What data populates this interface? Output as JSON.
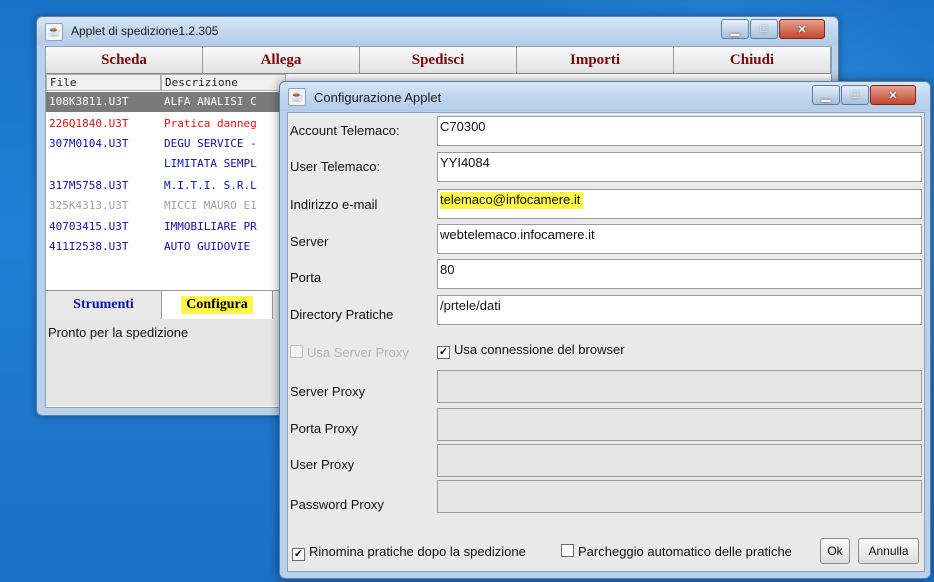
{
  "main_window": {
    "title": "Applet di spedizione1.2.305",
    "tabs": [
      "Scheda",
      "Allega",
      "Spedisci",
      "Importi",
      "Chiudi"
    ],
    "table": {
      "headers": [
        "File",
        "Descrizione"
      ],
      "rows": [
        {
          "file": "108K3811.U3T",
          "desc": "ALFA ANALISI C",
          "style": "sel"
        },
        {
          "file": "226Q1840.U3T",
          "desc": "Pratica danneg",
          "style": "red"
        },
        {
          "file": "307M0104.U3T",
          "desc": "DEGU SERVICE -",
          "style": "blue"
        },
        {
          "file": "",
          "desc": "LIMITATA SEMPL",
          "style": "blue"
        },
        {
          "file": "317M5758.U3T",
          "desc": "M.I.T.I. S.R.L",
          "style": "blue"
        },
        {
          "file": "325K4313.U3T",
          "desc": "MICCI MAURO E1",
          "style": "grey"
        },
        {
          "file": "40703415.U3T",
          "desc": "IMMOBILIARE PR",
          "style": "blue"
        },
        {
          "file": "411I2538.U3T",
          "desc": "AUTO GUIDOVIE",
          "style": "blue"
        }
      ]
    },
    "bottom_tabs": [
      "Strumenti",
      "Configura"
    ],
    "status": "Pronto per la spedizione"
  },
  "dialog": {
    "title": "Configurazione Applet",
    "fields": [
      {
        "label": "Account Telemaco:",
        "value": "C70300"
      },
      {
        "label": "User Telemaco:",
        "value": "YYI4084"
      },
      {
        "label": "Indirizzo e-mail",
        "value": "telemaco@infocamere.it"
      },
      {
        "label": "Server",
        "value": "webtelemaco.infocamere.it"
      },
      {
        "label": "Porta",
        "value": "80"
      },
      {
        "label": "Directory Pratiche",
        "value": "/prtele/dati"
      }
    ],
    "use_server_proxy": {
      "label": "Usa Server Proxy",
      "checked": false,
      "enabled": false
    },
    "use_browser_connection": {
      "label": "Usa connessione del browser",
      "checked": true
    },
    "proxy_fields": [
      {
        "label": "Server Proxy",
        "value": ""
      },
      {
        "label": "Porta Proxy",
        "value": ""
      },
      {
        "label": "User Proxy",
        "value": ""
      },
      {
        "label": "Password Proxy",
        "value": ""
      }
    ],
    "rename_after_send": {
      "label": "Rinomina pratiche dopo la spedizione",
      "checked": true
    },
    "auto_parking": {
      "label": "Parcheggio automatico delle pratiche",
      "checked": false
    },
    "ok_label": "Ok",
    "cancel_label": "Annulla"
  },
  "colors": {
    "highlight": "#fff84a",
    "tab_text": "#7a0a0a",
    "bottom_tab_text": "#1010a8"
  }
}
